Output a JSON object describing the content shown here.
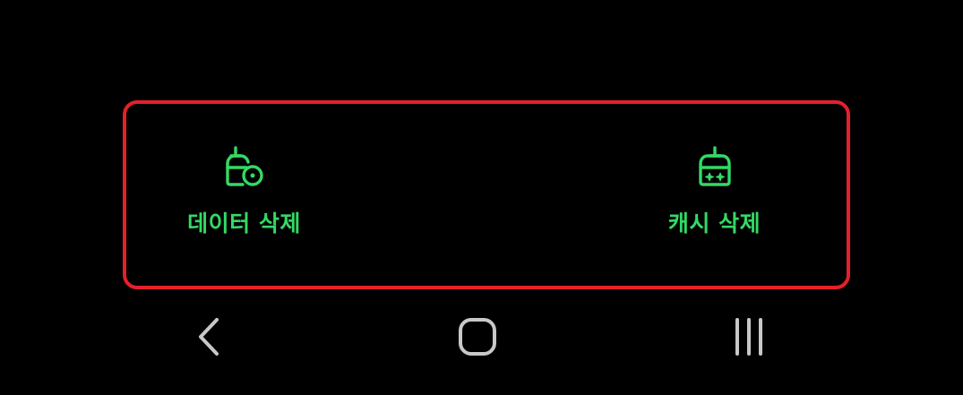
{
  "actions": {
    "delete_data": {
      "label": "데이터 삭제",
      "icon": "broom-with-disc-icon"
    },
    "delete_cache": {
      "label": "캐시 삭제",
      "icon": "broom-with-sparkles-icon"
    }
  },
  "navigation": {
    "back_icon": "back-chevron-icon",
    "home_icon": "home-rounded-square-icon",
    "recents_icon": "recent-apps-icon"
  },
  "colors": {
    "background": "#000000",
    "accent_green": "#34d965",
    "highlight_red": "#e5202a",
    "nav_gray": "#c8c8c8"
  }
}
